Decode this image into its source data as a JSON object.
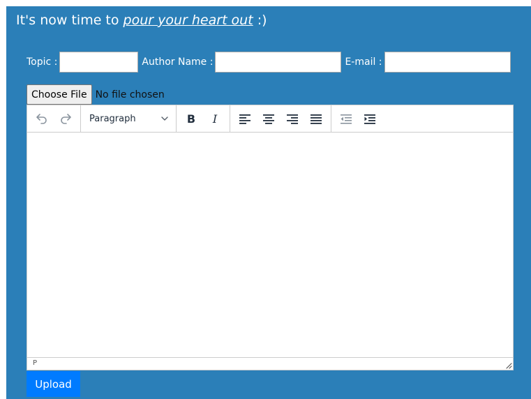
{
  "header": {
    "prefix": "It's now time to ",
    "emphasis": "pour your heart out",
    "suffix": " :)"
  },
  "form": {
    "topic_label": "Topic :",
    "topic_value": "",
    "author_label": "Author Name :",
    "author_value": "",
    "email_label": "E-mail :",
    "email_value": ""
  },
  "file": {
    "button_label": "Choose File",
    "status": "No file chosen"
  },
  "editor": {
    "toolbar": {
      "undo_icon": "undo-icon",
      "redo_icon": "redo-icon",
      "block_format": "Paragraph",
      "bold_label": "B",
      "italic_label": "I",
      "align_icons": [
        "align-left-icon",
        "align-center-icon",
        "align-right-icon",
        "align-justify-icon"
      ],
      "indent_icons": [
        "outdent-icon",
        "indent-icon"
      ]
    },
    "content": "",
    "status_path": "P"
  },
  "actions": {
    "upload_label": "Upload"
  },
  "colors": {
    "panel": "#2b7fb8",
    "upload_button": "#007bff",
    "toolbar_icon": "#222f3e",
    "disabled_icon": "#8a949e"
  }
}
